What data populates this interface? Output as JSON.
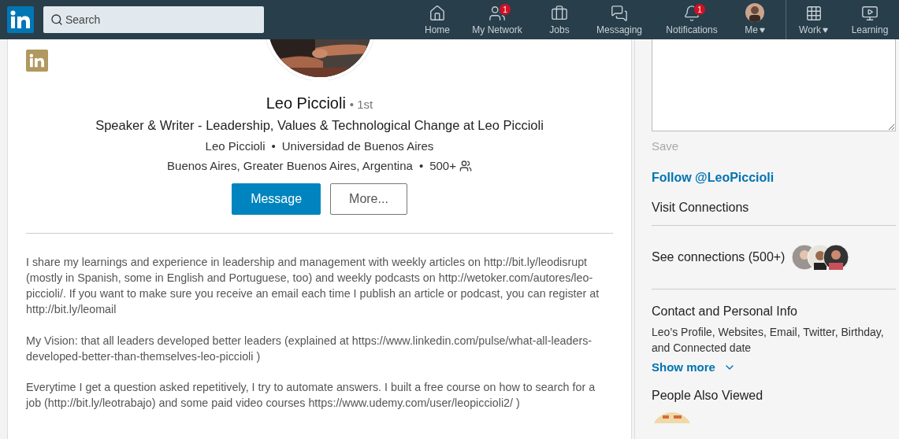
{
  "nav": {
    "search": {
      "placeholder": "Search"
    },
    "items": [
      {
        "kind": "home",
        "label": "Home",
        "caret": false,
        "divider_before": false
      },
      {
        "kind": "network",
        "label": "My Network",
        "badge": "1",
        "caret": false,
        "divider_before": false
      },
      {
        "kind": "jobs",
        "label": "Jobs",
        "caret": false,
        "divider_before": false
      },
      {
        "kind": "messaging",
        "label": "Messaging",
        "caret": false,
        "divider_before": false
      },
      {
        "kind": "notifications",
        "label": "Notifications",
        "badge": "1",
        "caret": false,
        "divider_before": false
      },
      {
        "kind": "me",
        "label": "Me",
        "caret": true,
        "divider_before": false
      },
      {
        "kind": "work",
        "label": "Work",
        "caret": true,
        "divider_before": true
      },
      {
        "kind": "learning",
        "label": "Learning",
        "caret": false,
        "divider_before": false
      }
    ]
  },
  "profile": {
    "name": "Leo Piccioli",
    "degree": "• 1st",
    "headline": "Speaker & Writer - Leadership, Values & Technological Change at Leo Piccioli",
    "company": "Leo Piccioli",
    "separator": "•",
    "school": "Universidad de Buenos Aires",
    "location": "Buenos Aires, Greater Buenos Aires, Argentina",
    "location_separator": "•",
    "connections": "500+",
    "buttons": [
      {
        "label": "Message",
        "primary": true
      },
      {
        "label": "More...",
        "primary": false
      }
    ]
  },
  "about": [
    "I share my learnings and experience in leadership and management with weekly articles on http://bit.ly/leodisrupt (mostly in Spanish, some in English and Portuguese, too) and weekly podcasts on http://wetoker.com/autores/leo-piccioli/. If you want to make sure you receive an email each time I publish an article or podcast, you can register at http://bit.ly/leomail",
    "My Vision: that all leaders developed better leaders (explained at https://www.linkedin.com/pulse/what-all-leaders-developed-better-than-themselves-leo-piccioli )",
    "Everytime I get a question asked repetitively, I try to automate answers. I built a free course on how to search for a job (http://bit.ly/leotrabajo) and some paid video courses https://www.udemy.com/user/leopiccioli2/ )"
  ],
  "sidebar": {
    "save": {
      "label": "Save",
      "disabled": true
    },
    "follow": "Follow @LeoPiccioli",
    "visit": "Visit Connections",
    "see_connections": "See connections (500+)",
    "contact_title": "Contact and Personal Info",
    "contact_text": "Leo’s Profile, Websites, Email, Twitter, Birthday, and Connected date",
    "show_more": "Show more",
    "people_title": "People Also Viewed"
  }
}
